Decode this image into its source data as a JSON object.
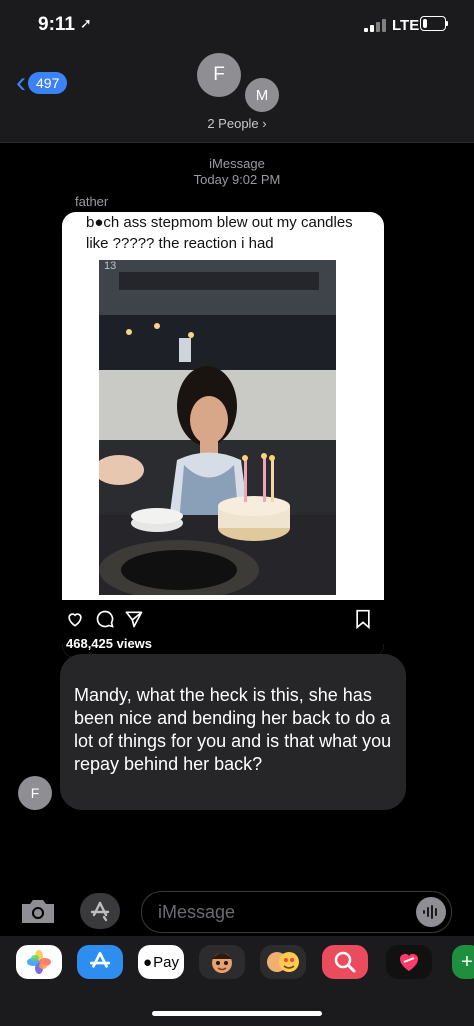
{
  "status": {
    "time": "9:11",
    "network": "LTE",
    "battery_level": 0.2
  },
  "header": {
    "back_count": "497",
    "avatar_1": "F",
    "avatar_2": "M",
    "people_label": "2 People",
    "people_chevron": "›"
  },
  "conversation": {
    "service": "iMessage",
    "timestamp": "Today 9:02 PM",
    "sender": "father",
    "shared_post": {
      "caption": "b●ch ass stepmom blew out my candles like ????? the reaction i had",
      "photo_counter": "13",
      "views": "468,425 views"
    },
    "message": "Mandy, what the heck is this, she has been nice and bending her back to do a lot of things for you and is that what you repay behind her back?",
    "sender_avatar": "F"
  },
  "compose": {
    "placeholder": "iMessage"
  },
  "app_drawer": {
    "apple_pay": "Pay"
  },
  "icons": [
    "location-arrow-icon",
    "signal-icon",
    "battery-icon",
    "back-chevron-icon",
    "chevron-right-icon",
    "heart-icon",
    "comment-icon",
    "send-icon",
    "bookmark-icon",
    "camera-icon",
    "app-store-icon",
    "microphone-waveform-icon",
    "photos-app-icon",
    "apple-pay-icon",
    "memoji-icon",
    "sticker-icon",
    "search-images-icon",
    "heart-app-icon"
  ],
  "colors": {
    "accent": "#3b82f6",
    "bubble_gray": "#262629",
    "background": "#000000"
  }
}
